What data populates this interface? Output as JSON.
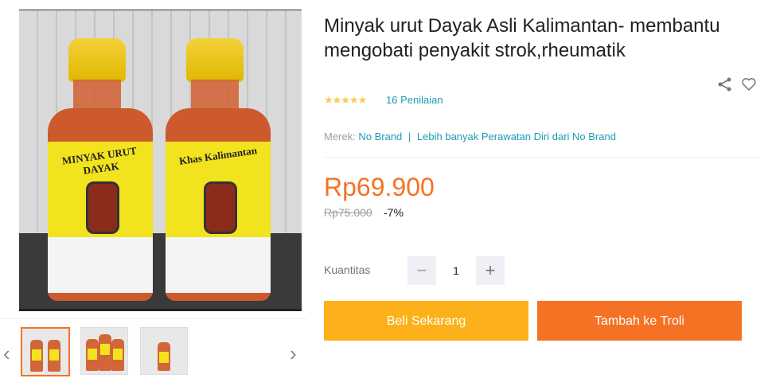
{
  "product": {
    "title": "Minyak urut Dayak Asli Kalimantan- membantu mengobati penyakit strok,rheumatik",
    "rating_stars": "★★★★★",
    "reviews_label": "16 Penilaian",
    "brand_label": "Merek:",
    "brand_value": "No Brand",
    "more_link": "Lebih banyak Perawatan Diri dari No Brand",
    "price": "Rp69.900",
    "original_price": "Rp75.000",
    "discount": "-7%",
    "quantity_label": "Kuantitas",
    "quantity": "1",
    "buy_now_label": "Beli Sekarang",
    "add_to_cart_label": "Tambah ke Troli"
  },
  "gallery": {
    "label_line1": "MINYAK URUT DAYAK",
    "label_line2": "Khas Kalimantan",
    "prev_arrow": "‹",
    "next_arrow": "›"
  },
  "icons": {
    "share": "share-icon",
    "wishlist": "heart-icon"
  },
  "colors": {
    "accent": "#f57224",
    "buy": "#fcb11a",
    "link": "#1a9cb7",
    "star": "#faca51"
  }
}
